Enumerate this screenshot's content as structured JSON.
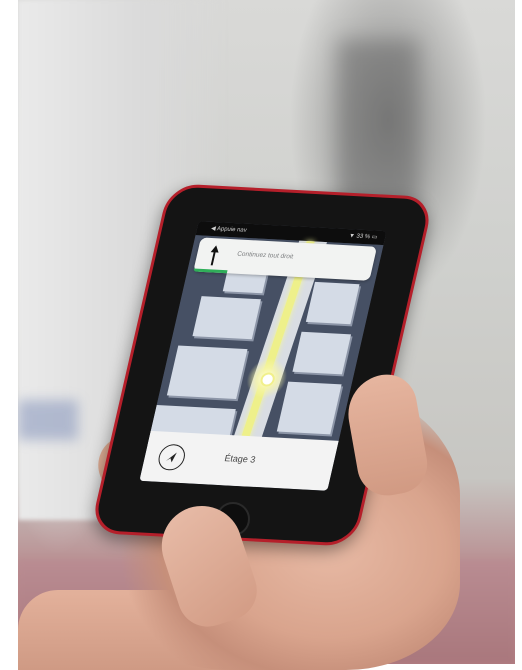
{
  "phone": {
    "status_left": "◀ Appuie nav",
    "status_right": "▼ 33 % ▭",
    "instruction_text": "Continuez tout droit",
    "floor_label": "Étage 3",
    "accent_color": "#2fae59",
    "route_color": "#eef08a",
    "frame_color": "#b51f2a"
  },
  "icons": {
    "direction": "arrow-up-icon",
    "locate": "navigation-arrow-icon"
  }
}
